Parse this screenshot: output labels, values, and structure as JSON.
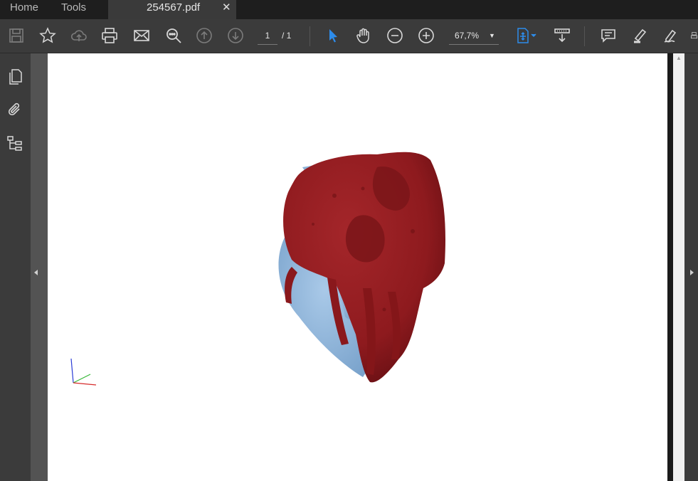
{
  "tabs": {
    "home_label": "Home",
    "tools_label": "Tools",
    "document_label": "254567.pdf",
    "close_label": "✕"
  },
  "toolbar": {
    "page_current": "1",
    "page_total": "/ 1",
    "zoom_value": "67,7%",
    "zoom_caret": "▼"
  },
  "colors": {
    "heart_red": "#8e1a1e",
    "vessel_blue": "#8fb6dc",
    "accent_blue": "#2d8ceb"
  }
}
